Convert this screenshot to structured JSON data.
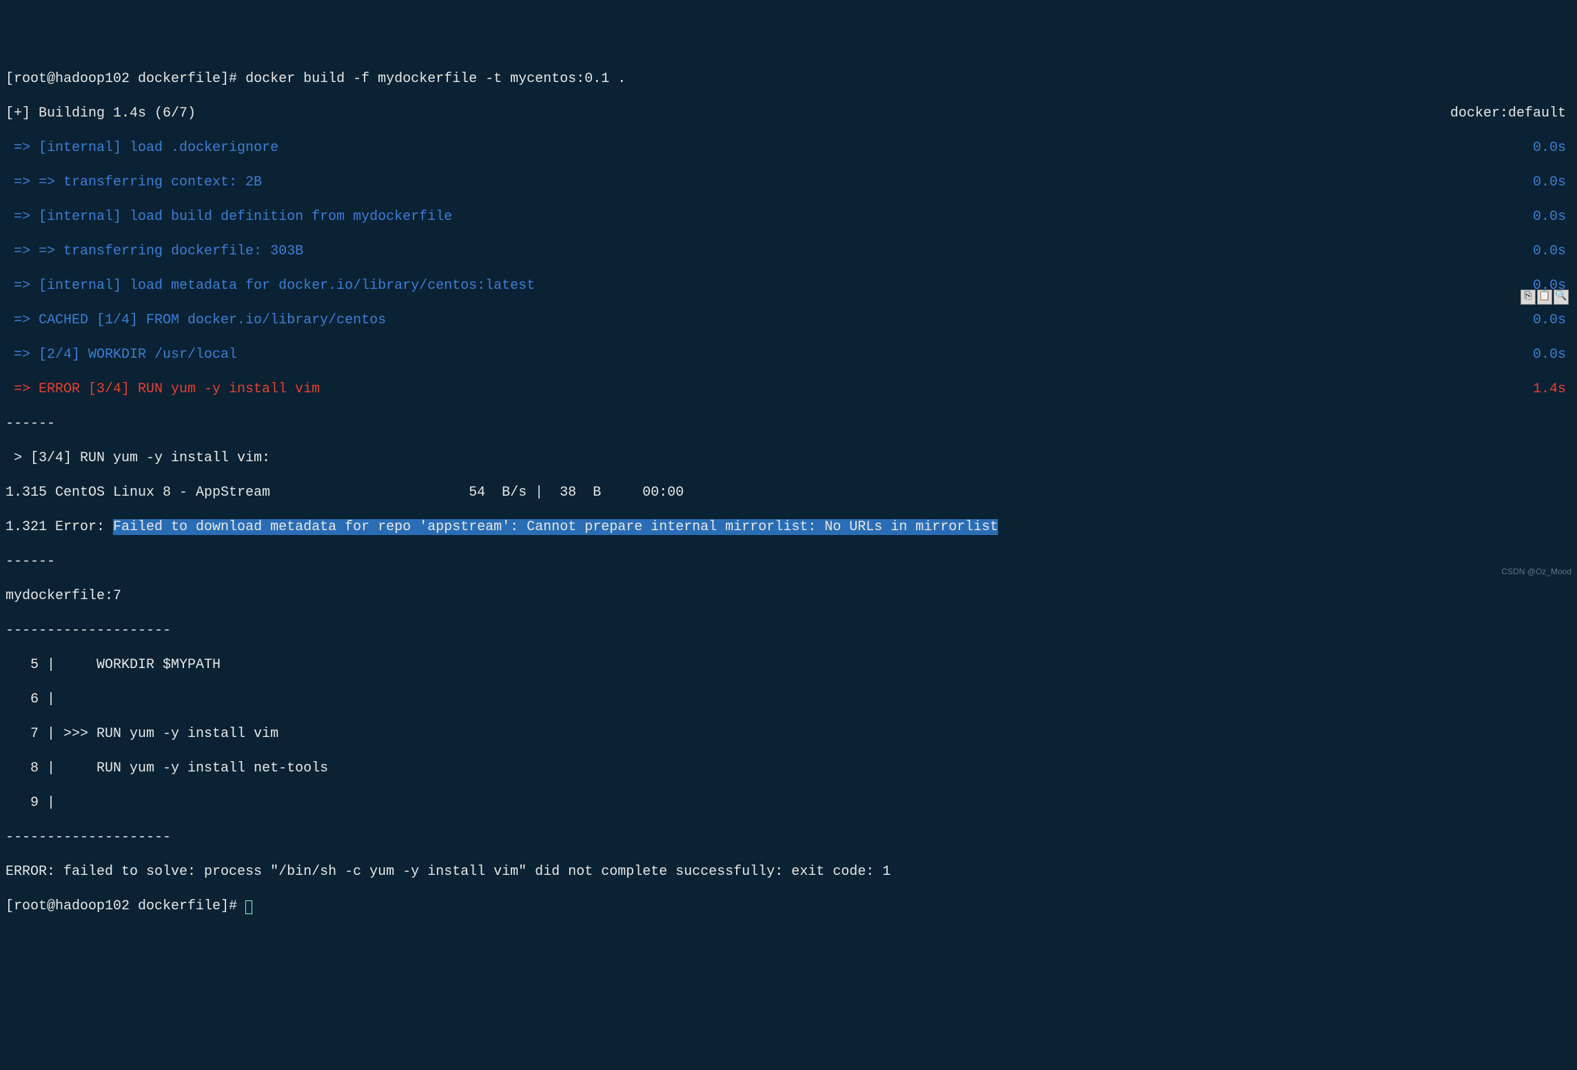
{
  "prompt1": {
    "user_host": "[root@hadoop102 dockerfile]#",
    "command": " docker build -f mydockerfile -t mycentos:0.1 ."
  },
  "building": {
    "left": "[+] Building 1.4s (6/7)",
    "right": "docker:default"
  },
  "steps": [
    {
      "left": " => [internal] load .dockerignore",
      "right": "0.0s",
      "cls": "blue"
    },
    {
      "left": " => => transferring context: 2B",
      "right": "0.0s",
      "cls": "blue"
    },
    {
      "left": " => [internal] load build definition from mydockerfile",
      "right": "0.0s",
      "cls": "blue"
    },
    {
      "left": " => => transferring dockerfile: 303B",
      "right": "0.0s",
      "cls": "blue"
    },
    {
      "left": " => [internal] load metadata for docker.io/library/centos:latest",
      "right": "0.0s",
      "cls": "blue"
    },
    {
      "left": " => CACHED [1/4] FROM docker.io/library/centos",
      "right": "0.0s",
      "cls": "blue"
    },
    {
      "left": " => [2/4] WORKDIR /usr/local",
      "right": "0.0s",
      "cls": "blue"
    },
    {
      "left": " => ERROR [3/4] RUN yum -y install vim",
      "right": "1.4s",
      "cls": "red"
    }
  ],
  "dash1": "------",
  "run_line": " > [3/4] RUN yum -y install vim:",
  "dl_line": "1.315 CentOS Linux 8 - AppStream                        54  B/s |  38  B     00:00",
  "err_prefix": "1.321 Error: ",
  "err_highlight": "Failed to download metadata for repo 'appstream': Cannot prepare internal mirrorlist: No URLs in mirrorlist",
  "dash2": "------",
  "file_ref": "mydockerfile:7",
  "dash3": "--------------------",
  "src": [
    "   5 |     WORKDIR $MYPATH",
    "   6 |     ",
    "   7 | >>> RUN yum -y install vim",
    "   8 |     RUN yum -y install net-tools",
    "   9 |     "
  ],
  "dash4": "--------------------",
  "final_error": "ERROR: failed to solve: process \"/bin/sh -c yum -y install vim\" did not complete successfully: exit code: 1",
  "prompt2": "[root@hadoop102 dockerfile]# ",
  "watermark": "CSDN @Oz_Mood",
  "toolbar": {
    "copy": "⎘",
    "paste": "📋",
    "search": "🔍"
  }
}
